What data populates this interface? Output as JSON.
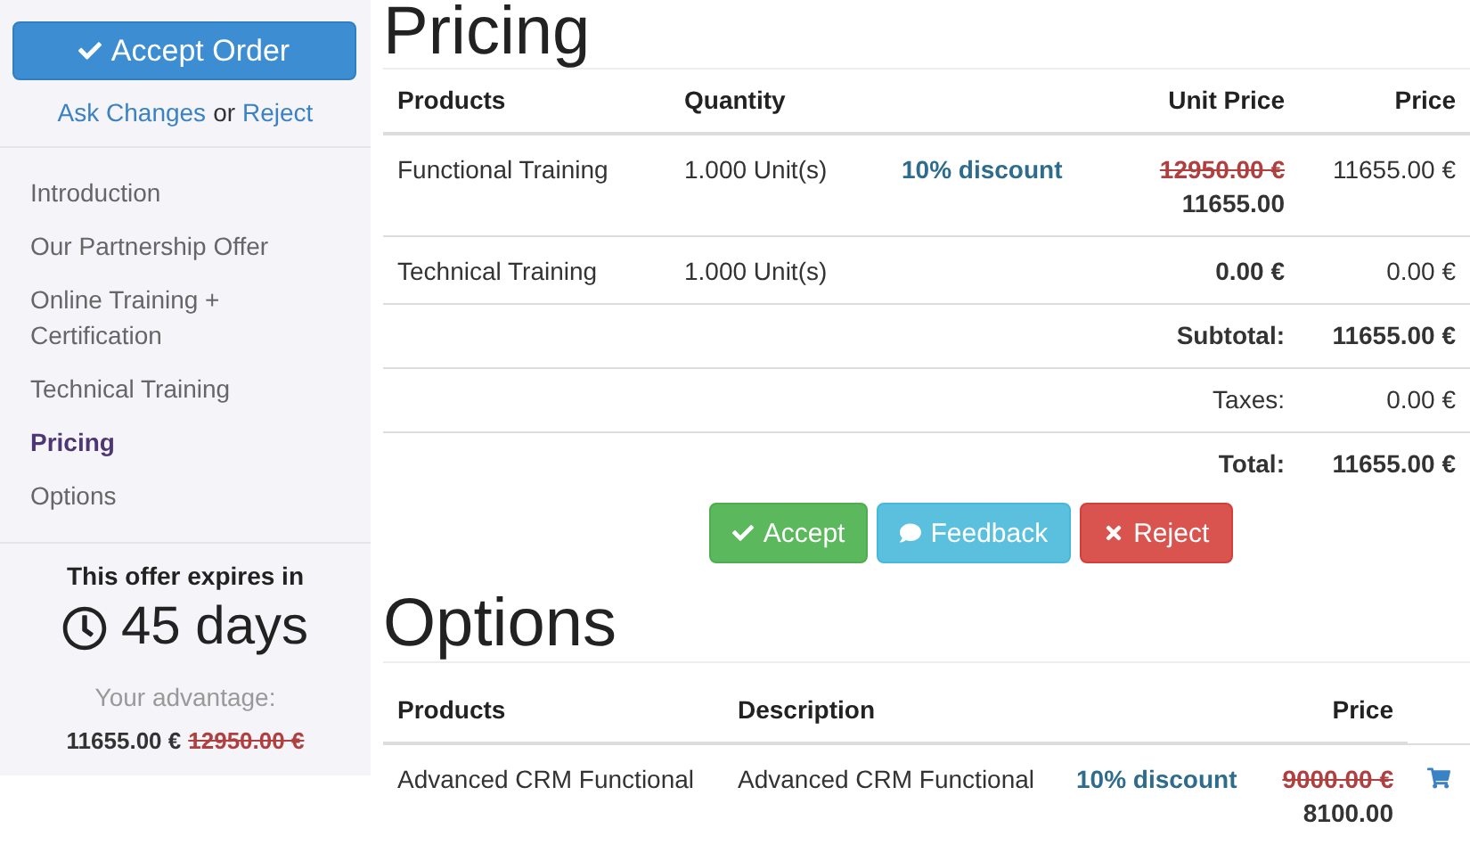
{
  "sidebar": {
    "accept_button": "Accept Order",
    "links": [
      {
        "label": "Ask Changes",
        "kind": "link"
      },
      {
        "label": "or",
        "kind": "text"
      },
      {
        "label": "Reject",
        "kind": "link"
      }
    ],
    "nav": [
      {
        "label": "Introduction",
        "selected": false
      },
      {
        "label": "Our Partnership Offer",
        "selected": false
      },
      {
        "label": "Online Training + Certification",
        "selected": false
      },
      {
        "label": "Technical Training",
        "selected": false
      },
      {
        "label": "Pricing",
        "selected": true
      },
      {
        "label": "Options",
        "selected": false
      }
    ],
    "expiry": {
      "label": "This offer expires in",
      "days": "45 days"
    },
    "advantage": {
      "label": "Your advantage:",
      "price": "11655.00 €",
      "old_price": "12950.00 €"
    }
  },
  "pricing": {
    "title": "Pricing",
    "columns": [
      "Products",
      "Quantity",
      "Unit Price",
      "Price"
    ],
    "rows": [
      {
        "product": "Functional Training",
        "quantity": "1.000 Unit(s)",
        "discount": "10% discount",
        "old_unit_price": "12950.00 €",
        "unit_price": "11655.00",
        "price": "11655.00 €"
      },
      {
        "product": "Technical Training",
        "quantity": "1.000 Unit(s)",
        "unit_price": "0.00 €",
        "price": "0.00 €"
      }
    ],
    "totals": [
      {
        "label": "Subtotal:",
        "value": "11655.00 €",
        "bold": true
      },
      {
        "label": "Taxes:",
        "value": "0.00 €",
        "bold": false
      },
      {
        "label": "Total:",
        "value": "11655.00 €",
        "bold": true
      }
    ],
    "buttons": [
      {
        "label": "Accept",
        "kind": "accept"
      },
      {
        "label": "Feedback",
        "kind": "feedback"
      },
      {
        "label": "Reject",
        "kind": "reject"
      }
    ]
  },
  "options": {
    "title": "Options",
    "columns": [
      "Products",
      "Description",
      "Price"
    ],
    "rows": [
      {
        "product": "Advanced CRM Functional",
        "description": "Advanced CRM Functional",
        "discount": "10% discount",
        "old_price": "9000.00 €",
        "price": "8100.00"
      }
    ]
  }
}
